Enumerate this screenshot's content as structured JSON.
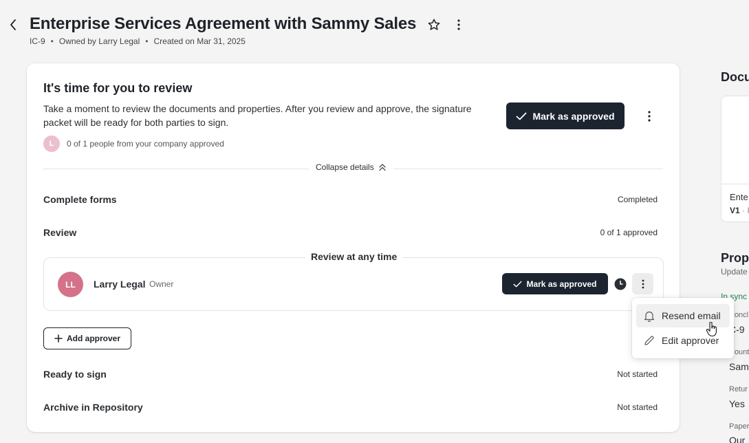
{
  "header": {
    "title": "Enterprise Services Agreement with Sammy Sales",
    "id": "IC-9",
    "owner": "Owned by Larry Legal",
    "created": "Created on Mar 31, 2025",
    "separator": "•"
  },
  "review_card": {
    "title": "It's time for you to review",
    "description": "Take a moment to review the documents and properties. After you review and approve, the signature packet will be ready for both parties to sign.",
    "avatar_initial": "L",
    "approved_summary": "0 of 1 people from your company approved",
    "approve_button": "Mark as approved",
    "collapse_label": "Collapse details"
  },
  "steps": [
    {
      "label": "Complete forms",
      "status": "Completed"
    },
    {
      "label": "Review",
      "status": "0 of 1 approved"
    },
    {
      "label": "Ready to sign",
      "status": "Not started"
    },
    {
      "label": "Archive in Repository",
      "status": "Not started"
    }
  ],
  "review_group": {
    "title": "Review at any time",
    "reviewer": {
      "initials": "LL",
      "name": "Larry Legal",
      "role": "Owner"
    },
    "approve_button": "Mark as approved"
  },
  "add_approver": "Add approver",
  "menu": {
    "items": [
      {
        "label": "Resend email",
        "icon": "bell-icon"
      },
      {
        "label": "Edit approver",
        "icon": "pencil-icon"
      }
    ]
  },
  "side_panel": {
    "documents_heading": "Docu",
    "doc_name": "Ente",
    "doc_version": "V1",
    "doc_version_rest": " · I",
    "properties_heading": "Prop",
    "updated": "Update",
    "sync": "In sync",
    "fields": [
      {
        "label": "Concl",
        "value": "C-9"
      },
      {
        "label": "Count",
        "value": "Samm"
      },
      {
        "label": "Retur",
        "value": "Yes"
      },
      {
        "label": "Paper",
        "value": "Our "
      }
    ]
  },
  "colors": {
    "primary_button": "#1c2430",
    "avatar_ll": "#d47289",
    "avatar_l": "#ecbfd0",
    "sync_green": "#1a7f4b"
  }
}
